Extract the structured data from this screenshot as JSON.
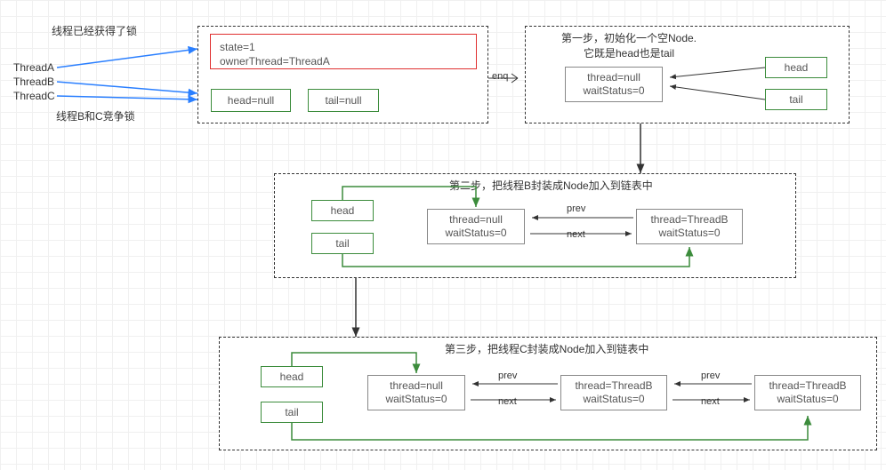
{
  "labels": {
    "lock_acquired": "线程已经获得了锁",
    "competing": "线程B和C竞争锁",
    "threadA": "ThreadA",
    "threadB": "ThreadB",
    "threadC": "ThreadC",
    "enq": "enq"
  },
  "state": {
    "line1": "state=1",
    "line2": "ownerThread=ThreadA"
  },
  "ptr": {
    "head": "head",
    "tail": "tail",
    "head_null": "head=null",
    "tail_null": "tail=null"
  },
  "step1": {
    "title_l1": "第一步，初始化一个空Node.",
    "title_l2": "它既是head也是tail",
    "node_l1": "thread=null",
    "node_l2": "waitStatus=0"
  },
  "step2": {
    "title": "第二步，把线程B封装成Node加入到链表中",
    "n0_l1": "thread=null",
    "n0_l2": "waitStatus=0",
    "n1_l1": "thread=ThreadB",
    "n1_l2": "waitStatus=0",
    "prev": "prev",
    "next": "next"
  },
  "step3": {
    "title": "第三步，把线程C封装成Node加入到链表中",
    "n0_l1": "thread=null",
    "n0_l2": "waitStatus=0",
    "n1_l1": "thread=ThreadB",
    "n1_l2": "waitStatus=0",
    "n2_l1": "thread=ThreadB",
    "n2_l2": "waitStatus=0",
    "prev": "prev",
    "next": "next"
  }
}
